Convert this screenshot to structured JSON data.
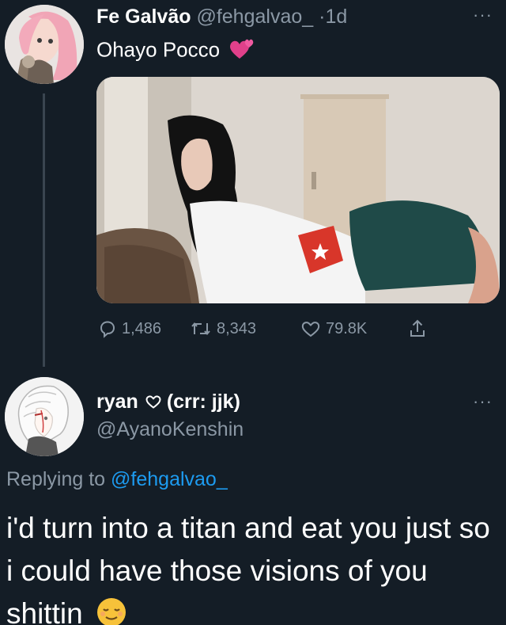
{
  "tweet": {
    "display_name": "Fe Galvão",
    "handle": "@fehgalvao_",
    "separator": "·",
    "time": "1d",
    "text": "Ohayo Pocco",
    "emoji": "two-hearts",
    "stats": {
      "replies": "1,486",
      "retweets": "8,343",
      "likes": "79.8K"
    }
  },
  "reply": {
    "display_name": "ryan",
    "name_suffix": "(crr: jjk)",
    "handle": "@AyanoKenshin",
    "replying_prefix": "Replying to",
    "replying_to": "@fehgalvao_",
    "text": "i'd turn into a titan and eat you just so i could have those visions of you shittin",
    "emoji": "relieved-face"
  },
  "colors": {
    "background": "#141d26",
    "muted": "#8b98a5",
    "link": "#1d9bf0",
    "text": "#ffffff"
  }
}
